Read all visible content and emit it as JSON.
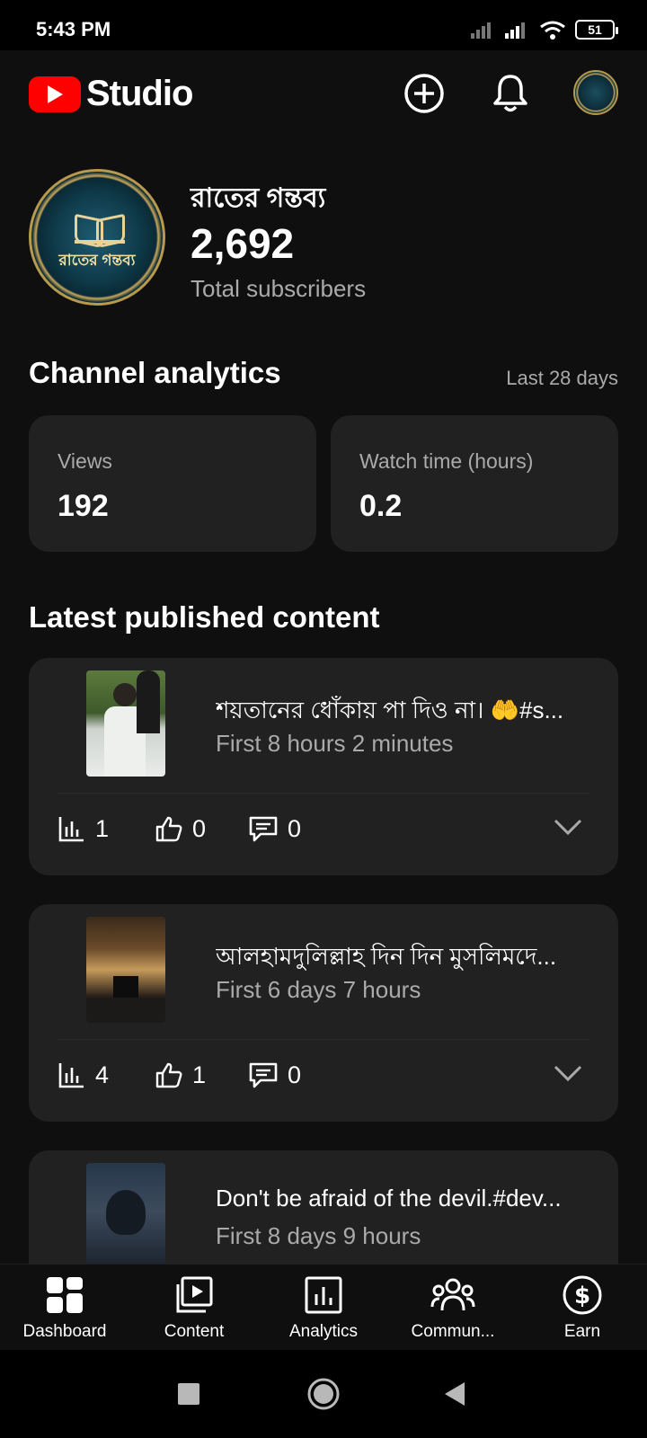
{
  "status_bar": {
    "time": "5:43 PM",
    "battery": "51"
  },
  "header": {
    "logo_text": "Studio"
  },
  "channel": {
    "avatar_text": "রাতের গন্তব্য",
    "name": "রাতের গন্তব্য",
    "subscribers": "2,692",
    "subscribers_label": "Total subscribers"
  },
  "analytics": {
    "title": "Channel analytics",
    "period": "Last 28 days",
    "stats": [
      {
        "label": "Views",
        "value": "192"
      },
      {
        "label": "Watch time (hours)",
        "value": "0.2"
      }
    ]
  },
  "latest": {
    "title": "Latest published content",
    "items": [
      {
        "title": "শয়তানের ধোঁকায় পা দিও না। 🤲#s...",
        "meta": "First 8 hours 2 minutes",
        "views": "1",
        "likes": "0",
        "comments": "0"
      },
      {
        "title": "আলহামদুলিল্লাহ দিন দিন মুসলিমদে...",
        "meta": "First 6 days 7 hours",
        "views": "4",
        "likes": "1",
        "comments": "0"
      },
      {
        "title": "Don't be afraid of the devil.#dev...",
        "meta": "First 8 days 9 hours",
        "views": "",
        "likes": "",
        "comments": ""
      }
    ]
  },
  "bottom_nav": {
    "items": [
      {
        "label": "Dashboard",
        "icon": "dashboard-icon"
      },
      {
        "label": "Content",
        "icon": "content-icon"
      },
      {
        "label": "Analytics",
        "icon": "analytics-icon"
      },
      {
        "label": "Commun...",
        "icon": "community-icon"
      },
      {
        "label": "Earn",
        "icon": "earn-icon"
      }
    ]
  },
  "colors": {
    "background": "#0f0f0f",
    "card": "#212121",
    "accent": "#ff0000",
    "muted_text": "#aaaaaa"
  }
}
